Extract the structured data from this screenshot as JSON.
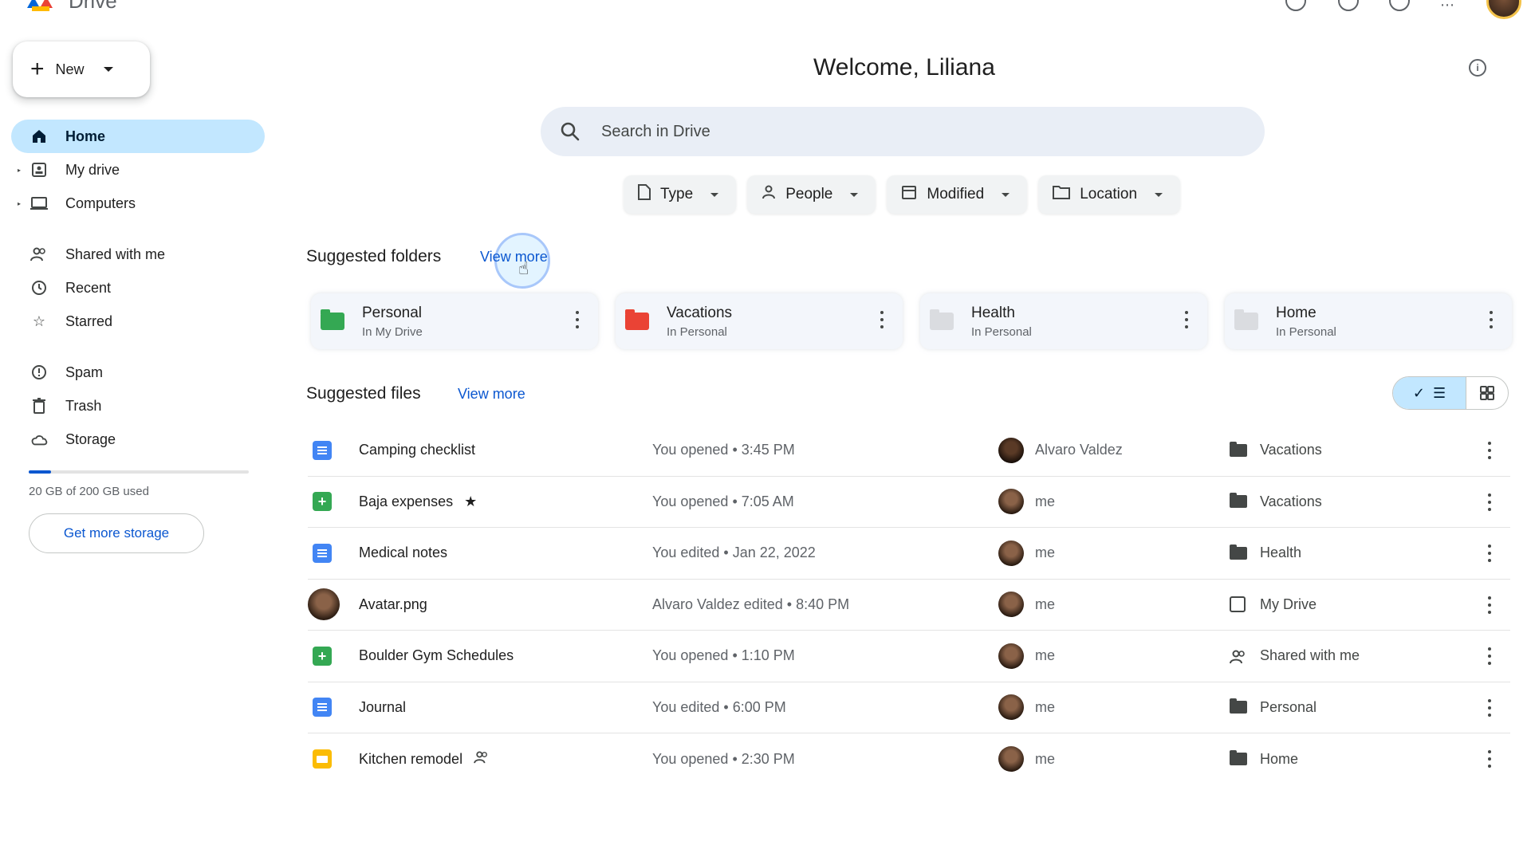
{
  "app": {
    "brand": "Drive"
  },
  "sidebar": {
    "new_label": "New",
    "items": [
      {
        "label": "Home",
        "icon": "home-icon",
        "active": true
      },
      {
        "label": "My drive",
        "icon": "my-drive-icon",
        "expandable": true
      },
      {
        "label": "Computers",
        "icon": "computer-icon",
        "expandable": true
      },
      {
        "label": "Shared with me",
        "icon": "people-icon"
      },
      {
        "label": "Recent",
        "icon": "clock-icon"
      },
      {
        "label": "Starred",
        "icon": "star-icon"
      },
      {
        "label": "Spam",
        "icon": "spam-icon"
      },
      {
        "label": "Trash",
        "icon": "trash-icon"
      },
      {
        "label": "Storage",
        "icon": "cloud-icon"
      }
    ],
    "storage": {
      "used_text": "20 GB of 200 GB used",
      "used_fraction": 0.1,
      "cta": "Get more storage"
    }
  },
  "main": {
    "welcome": "Welcome, Liliana",
    "search": {
      "placeholder": "Search in Drive"
    },
    "filters": [
      {
        "label": "Type",
        "icon": "file-icon"
      },
      {
        "label": "People",
        "icon": "person-icon"
      },
      {
        "label": "Modified",
        "icon": "calendar-icon"
      },
      {
        "label": "Location",
        "icon": "folder-outline-icon"
      }
    ],
    "suggested_folders": {
      "title": "Suggested folders",
      "view_more": "View more",
      "items": [
        {
          "name": "Personal",
          "location": "In My Drive",
          "color": "#34a853"
        },
        {
          "name": "Vacations",
          "location": "In Personal",
          "color": "#ea4335"
        },
        {
          "name": "Health",
          "location": "In Personal",
          "color": "#dadce0"
        },
        {
          "name": "Home",
          "location": "In Personal",
          "color": "#dadce0"
        }
      ]
    },
    "suggested_files": {
      "title": "Suggested files",
      "view_more": "View more",
      "items": [
        {
          "name": "Camping checklist",
          "type": "doc",
          "activity": "You opened • 3:45 PM",
          "owner": "Alvaro Valdez",
          "location": "Vacations",
          "location_icon": "folder"
        },
        {
          "name": "Baja expenses",
          "type": "sheet",
          "starred": true,
          "activity": "You opened • 7:05 AM",
          "owner": "me",
          "location": "Vacations",
          "location_icon": "folder"
        },
        {
          "name": "Medical notes",
          "type": "doc",
          "activity": "You edited • Jan 22, 2022",
          "owner": "me",
          "location": "Health",
          "location_icon": "folder"
        },
        {
          "name": "Avatar.png",
          "type": "image",
          "activity": "Alvaro Valdez edited • 8:40 PM",
          "owner": "me",
          "location": "My Drive",
          "location_icon": "drive"
        },
        {
          "name": "Boulder Gym Schedules",
          "type": "sheet",
          "activity": "You opened • 1:10 PM",
          "owner": "me",
          "location": "Shared with me",
          "location_icon": "people"
        },
        {
          "name": "Journal",
          "type": "doc",
          "activity": "You edited • 6:00 PM",
          "owner": "me",
          "location": "Personal",
          "location_icon": "folder"
        },
        {
          "name": "Kitchen remodel",
          "type": "slides",
          "shared": true,
          "activity": "You opened • 2:30 PM",
          "owner": "me",
          "location": "Home",
          "location_icon": "folder"
        }
      ]
    }
  },
  "colors": {
    "accent": "#0b57d0",
    "active_bg": "#c2e7ff",
    "search_bg": "#e9eef6"
  }
}
